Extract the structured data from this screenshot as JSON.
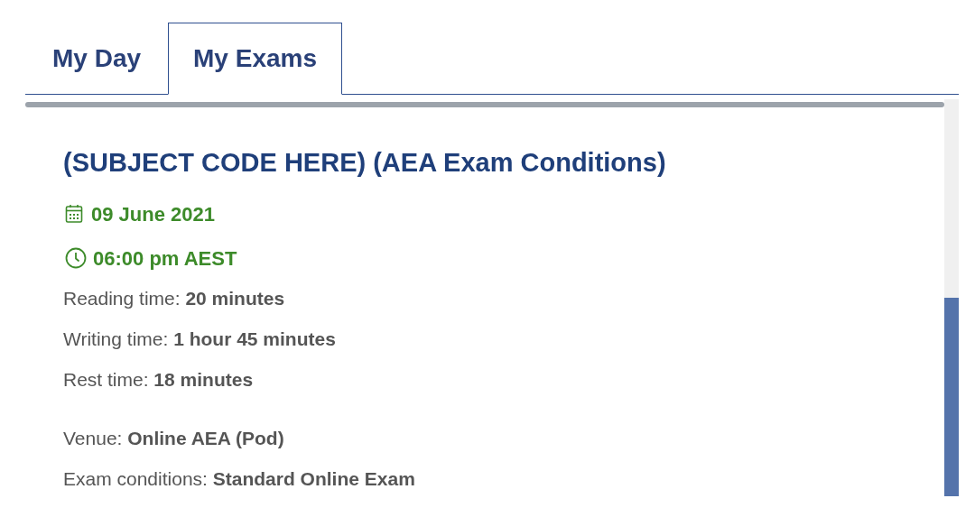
{
  "tabs": [
    {
      "label": "My Day",
      "selected": false
    },
    {
      "label": "My Exams",
      "selected": true
    }
  ],
  "exam": {
    "title": "(SUBJECT CODE HERE) (AEA Exam Conditions)",
    "date": "09 June 2021",
    "time": "06:00 pm AEST",
    "durations": [
      "Reading time: **20 minutes**",
      "Writing time: **1 hour 45 minutes**",
      "Rest time: **18 minutes**"
    ],
    "details": [
      "Venue: **Online AEA (Pod)**",
      "Exam conditions: **Standard Online Exam**"
    ]
  }
}
